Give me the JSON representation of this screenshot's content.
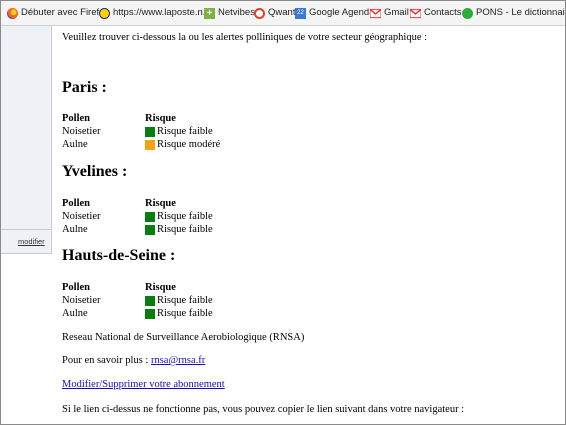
{
  "bookmarks": [
    {
      "label": "Débuter avec Firefox",
      "icon": "firefox-icon"
    },
    {
      "label": "https://www.laposte.n...",
      "icon": "laposte-icon"
    },
    {
      "label": "Netvibes",
      "icon": "netvibes-icon"
    },
    {
      "label": "Qwant",
      "icon": "qwant-icon"
    },
    {
      "label": "Google Agenda",
      "icon": "google-agenda-icon"
    },
    {
      "label": "Gmail",
      "icon": "gmail-icon"
    },
    {
      "label": "Contacts",
      "icon": "gmail-icon"
    },
    {
      "label": "PONS - Le dictionnair...",
      "icon": "pons-icon"
    }
  ],
  "sidebar": {
    "modifier_label": "modifier"
  },
  "email": {
    "intro": "Veuillez trouver ci-dessous la ou les alertes polliniques de votre secteur géographique :",
    "col_pollen": "Pollen",
    "col_risque": "Risque",
    "colors": {
      "faible": "#0a7d12",
      "modere": "#f0a418"
    },
    "regions": [
      {
        "name": "Paris :",
        "rows": [
          {
            "pollen": "Noisetier",
            "risk": "Risque faible",
            "level": "faible"
          },
          {
            "pollen": "Aulne",
            "risk": "Risque modéré",
            "level": "modere"
          }
        ]
      },
      {
        "name": "Yvelines :",
        "rows": [
          {
            "pollen": "Noisetier",
            "risk": "Risque faible",
            "level": "faible"
          },
          {
            "pollen": "Aulne",
            "risk": "Risque faible",
            "level": "faible"
          }
        ]
      },
      {
        "name": "Hauts-de-Seine :",
        "rows": [
          {
            "pollen": "Noisetier",
            "risk": "Risque faible",
            "level": "faible"
          },
          {
            "pollen": "Aulne",
            "risk": "Risque faible",
            "level": "faible"
          }
        ]
      }
    ],
    "network": "Reseau National de Surveillance Aerobiologique (RNSA)",
    "more_info_prefix": "Pour en savoir plus : ",
    "more_info_link": "rnsa@rnsa.fr",
    "manage_link": "Modifier/Supprimer votre abonnement",
    "fallback_text": "Si le lien ci-dessus ne fonctionne pas, vous pouvez copier le lien suivant dans votre navigateur :"
  }
}
